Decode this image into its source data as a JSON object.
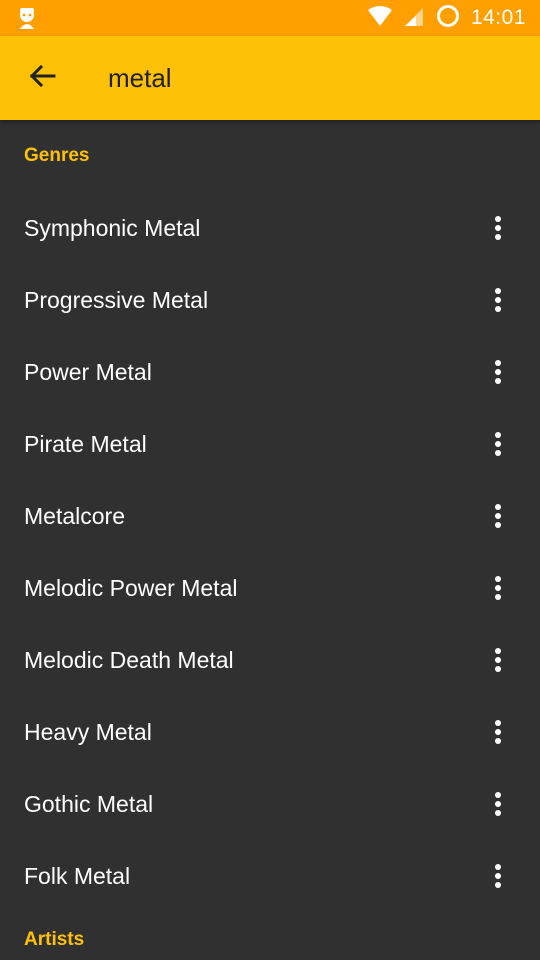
{
  "status_bar": {
    "time": "14:01",
    "left_icon": "notification-app-icon",
    "icons": [
      "wifi-icon",
      "cell-signal-icon",
      "battery-ring-icon"
    ]
  },
  "app_bar": {
    "back_icon": "arrow-back-icon",
    "search_value": "metal"
  },
  "sections": {
    "genres_title": "Genres",
    "artists_title": "Artists"
  },
  "genres": [
    {
      "label": "Symphonic Metal"
    },
    {
      "label": "Progressive Metal"
    },
    {
      "label": "Power Metal"
    },
    {
      "label": "Pirate Metal"
    },
    {
      "label": "Metalcore"
    },
    {
      "label": "Melodic Power Metal"
    },
    {
      "label": "Melodic Death Metal"
    },
    {
      "label": "Heavy Metal"
    },
    {
      "label": "Gothic Metal"
    },
    {
      "label": "Folk Metal"
    }
  ],
  "colors": {
    "status_bar": "#FFA000",
    "app_bar": "#FFC107",
    "accent": "#FFC107",
    "background": "#303030",
    "text_primary": "#FFFFFF"
  }
}
